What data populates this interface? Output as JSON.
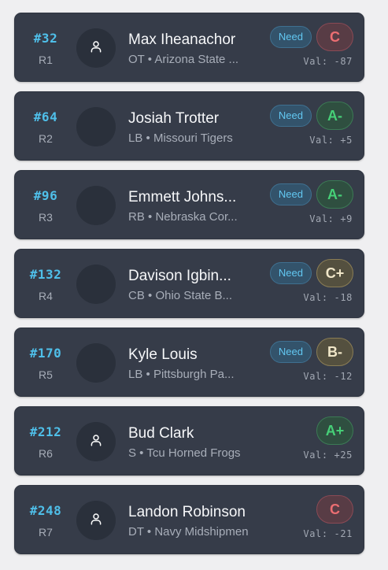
{
  "val_prefix": "Val:",
  "need_label": "Need",
  "grade_colors": {
    "red": "#ec6e72",
    "green": "#46cf77",
    "amber": "#f0e6c8"
  },
  "accent": "#4fbfe9",
  "picks": [
    {
      "pick": "#32",
      "round": "R1",
      "name": "Max Iheanachor",
      "position": "OT",
      "school": "Arizona State ...",
      "need": true,
      "grade": "C",
      "grade_tone": "red",
      "value": "-87",
      "avatar_icon": "person-icon"
    },
    {
      "pick": "#64",
      "round": "R2",
      "name": "Josiah Trotter",
      "position": "LB",
      "school": "Missouri Tigers",
      "need": true,
      "grade": "A-",
      "grade_tone": "green",
      "value": "+5",
      "avatar_icon": ""
    },
    {
      "pick": "#96",
      "round": "R3",
      "name": "Emmett Johns...",
      "position": "RB",
      "school": "Nebraska Cor...",
      "need": true,
      "grade": "A-",
      "grade_tone": "green",
      "value": "+9",
      "avatar_icon": ""
    },
    {
      "pick": "#132",
      "round": "R4",
      "name": "Davison Igbin...",
      "position": "CB",
      "school": "Ohio State B...",
      "need": true,
      "grade": "C+",
      "grade_tone": "amber",
      "value": "-18",
      "avatar_icon": ""
    },
    {
      "pick": "#170",
      "round": "R5",
      "name": "Kyle Louis",
      "position": "LB",
      "school": "Pittsburgh Pa...",
      "need": true,
      "grade": "B-",
      "grade_tone": "amber",
      "value": "-12",
      "avatar_icon": ""
    },
    {
      "pick": "#212",
      "round": "R6",
      "name": "Bud Clark",
      "position": "S",
      "school": "Tcu Horned Frogs",
      "need": false,
      "grade": "A+",
      "grade_tone": "green",
      "value": "+25",
      "avatar_icon": "person-icon"
    },
    {
      "pick": "#248",
      "round": "R7",
      "name": "Landon Robinson",
      "position": "DT",
      "school": "Navy Midshipmen",
      "need": false,
      "grade": "C",
      "grade_tone": "red",
      "value": "-21",
      "avatar_icon": "person-icon"
    }
  ]
}
